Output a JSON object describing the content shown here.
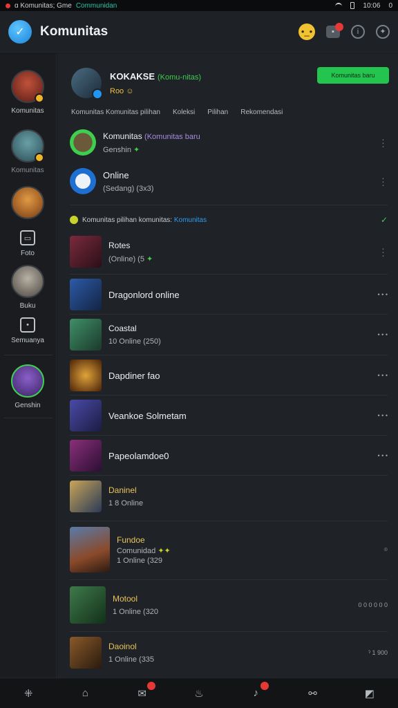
{
  "status_bar": {
    "left_text": "ɑ Komunitas; Gme",
    "accent_text": "Communidan",
    "time": "10:06",
    "right_num": "0"
  },
  "header": {
    "title": "Komunitas"
  },
  "sidebar": {
    "items": [
      {
        "label": "Komunitas"
      },
      {
        "label": "Komunitas"
      },
      {
        "label": ""
      },
      {
        "label": "Foto"
      },
      {
        "label": "Buku"
      },
      {
        "label": "Semuanya"
      },
      {
        "label": "Genshin"
      }
    ]
  },
  "profile": {
    "name": "KOKAKSE",
    "tag": "(Komu-nitas)",
    "sub": "Roo",
    "join_label": "Komunitas baru"
  },
  "tabs": [
    "Komunitas Komunitas pilihan",
    "Koleksi",
    "Pilihan",
    "Rekomendasi"
  ],
  "rows_top": [
    {
      "title": "Komunitas",
      "title_extra": "(Komunitas baru",
      "sub": "Genshin"
    },
    {
      "title": "Online",
      "sub": "(Sedang) (3x3)"
    }
  ],
  "section": {
    "prefix": "Komunitas pilihan komunitas:",
    "highlight": "Komunitas"
  },
  "game_rows": [
    {
      "title": "Rotes",
      "sub": "(Online) (5",
      "meta": ""
    },
    {
      "title": "Dragonlord online",
      "sub": "",
      "meta": "• • •"
    },
    {
      "title": "Coastal",
      "sub": "10 Online (250)",
      "meta": "• • •"
    },
    {
      "title": "Dapdiner fao",
      "sub": "",
      "meta": "• • •"
    },
    {
      "title": "Veankoe Solmetam",
      "sub": "",
      "meta": "• • •"
    },
    {
      "title": "Papeolamdoe0",
      "sub": "",
      "meta": "• • •"
    },
    {
      "title": "Daninel",
      "sub": "1 8 Online",
      "meta": ""
    },
    {
      "title": "Fundoe",
      "title2": "Comunidad",
      "sub": "1 Online (329",
      "meta": ""
    },
    {
      "title": "Motool",
      "sub": "1 Online (320",
      "meta": "0 0 0 0 0 0"
    },
    {
      "title": "Daoinol",
      "sub": "1 Online (335",
      "meta": "ˀ 1 900"
    }
  ]
}
